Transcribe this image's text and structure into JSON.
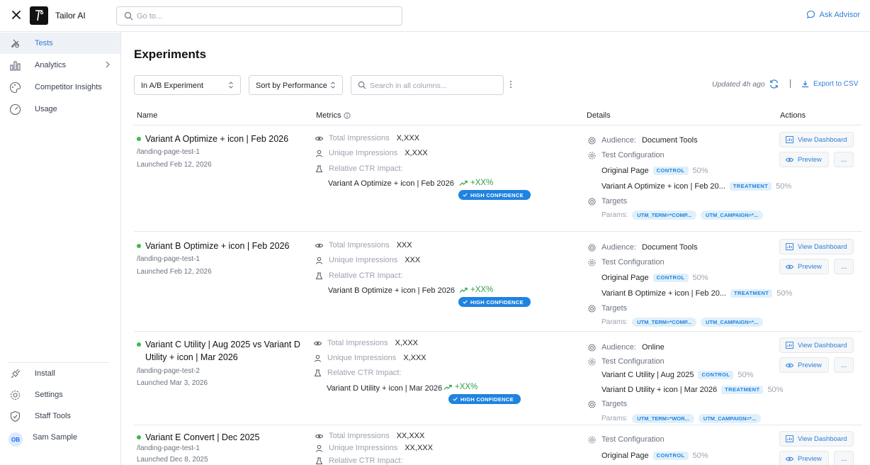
{
  "app": {
    "title": "Tailor AI"
  },
  "goto": {
    "placeholder": "Go to..."
  },
  "ask_advisor": "Ask Advisor",
  "sidebar": {
    "items": [
      {
        "label": "Tests"
      },
      {
        "label": "Analytics"
      },
      {
        "label": "Competitor Insights"
      },
      {
        "label": "Usage"
      }
    ],
    "bottom_items": [
      {
        "label": "Install"
      },
      {
        "label": "Settings"
      },
      {
        "label": "Staff Tools"
      }
    ],
    "user": {
      "initials": "OB",
      "name": "Sam Sample"
    }
  },
  "main": {
    "title": "Experiments",
    "filter_select": "In A/B Experiment",
    "sort_select": "Sort by Performance",
    "search_placeholder": "Search in all columns...",
    "updated": "Updated 4h ago",
    "export": "Export to CSV",
    "columns": {
      "name": "Name",
      "metrics": "Metrics",
      "details": "Details",
      "actions": "Actions"
    }
  },
  "labels": {
    "total_impressions": "Total Impressions",
    "unique_impressions": "Unique Impressions",
    "relative_ctr": "Relative CTR Impact:",
    "audience": "Audience:",
    "test_configuration": "Test Configuration",
    "targets": "Targets",
    "params": "Params:",
    "control": "CONTROL",
    "treatment": "TREATMENT",
    "high_confidence": "HIGH CONFIDENCE",
    "view_dashboard": "View Dashboard",
    "preview": "Preview",
    "more": "..."
  },
  "rows": [
    {
      "name": "Variant A Optimize + icon | Feb 2026",
      "path": "/landing-page-test-1",
      "launched": "Launched Feb 12, 2026",
      "total_impressions": "X,XXX",
      "unique_impressions": "X,XXX",
      "ctr_variant": "Variant A Optimize + icon | Feb 2026",
      "uplift": "+XX%",
      "audience": "Document Tools",
      "config": [
        {
          "name": "Original Page",
          "pct": "50%"
        },
        {
          "name": "Variant A Optimize + icon | Feb 20...",
          "pct": "50%"
        }
      ],
      "params": [
        "UTM_TERM=*COMP...",
        "UTM_CAMPAIGN=*..."
      ]
    },
    {
      "name": "Variant B Optimize + icon | Feb 2026",
      "path": "/landing-page-test-1",
      "launched": "Launched Feb 12, 2026",
      "total_impressions": "XXX",
      "unique_impressions": "XXX",
      "ctr_variant": "Variant B Optimize + icon | Feb 2026",
      "uplift": "+XX%",
      "audience": "Document Tools",
      "config": [
        {
          "name": "Original Page",
          "pct": "50%"
        },
        {
          "name": "Variant B Optimize + icon | Feb 20...",
          "pct": "50%"
        }
      ],
      "params": [
        "UTM_TERM=*COMP...",
        "UTM_CAMPAIGN=*..."
      ]
    },
    {
      "name_line1": "Variant C Utility | Aug 2025 vs Variant D",
      "name_line2": "Utility + icon | Mar 2026",
      "path": "/landing-page-test-2",
      "launched": "Launched Mar 3, 2026",
      "total_impressions": "X,XXX",
      "unique_impressions": "X,XXX",
      "ctr_variant": "Variant D Utility + icon | Mar 2026",
      "uplift": "+XX%",
      "audience": "Online",
      "config": [
        {
          "name": "Variant C Utility | Aug 2025",
          "pct": "50%"
        },
        {
          "name": "Variant D Utility + icon | Mar 2026",
          "pct": "50%"
        }
      ],
      "params": [
        "UTM_TERM=*WOR...",
        "UTM_CAMPAIGN=*..."
      ]
    },
    {
      "name": "Variant E Convert | Dec 2025",
      "path": "/landing-page-test-1",
      "launched": "Launched Dec 8, 2025",
      "total_impressions": "XX,XXX",
      "unique_impressions": "XX,XXX",
      "config": [
        {
          "name": "Original Page",
          "pct": "50%"
        }
      ]
    }
  ]
}
